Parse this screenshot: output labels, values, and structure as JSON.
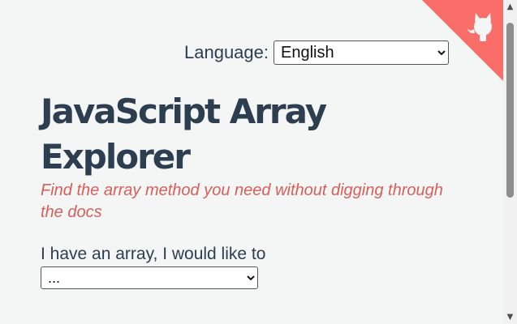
{
  "language": {
    "label": "Language:",
    "selected": "English"
  },
  "header": {
    "title": "JavaScript Array Explorer",
    "subtitle": "Find the array method you need without digging through the docs"
  },
  "main": {
    "prompt": "I have an array, I would like to",
    "method_select": {
      "selected": "..."
    }
  },
  "corner": {
    "icon": "github-octocat-icon",
    "color": "#fa6e6a"
  },
  "colors": {
    "text": "#2d3e50",
    "accent": "#d65f5a",
    "background": "#f4f5f5"
  }
}
